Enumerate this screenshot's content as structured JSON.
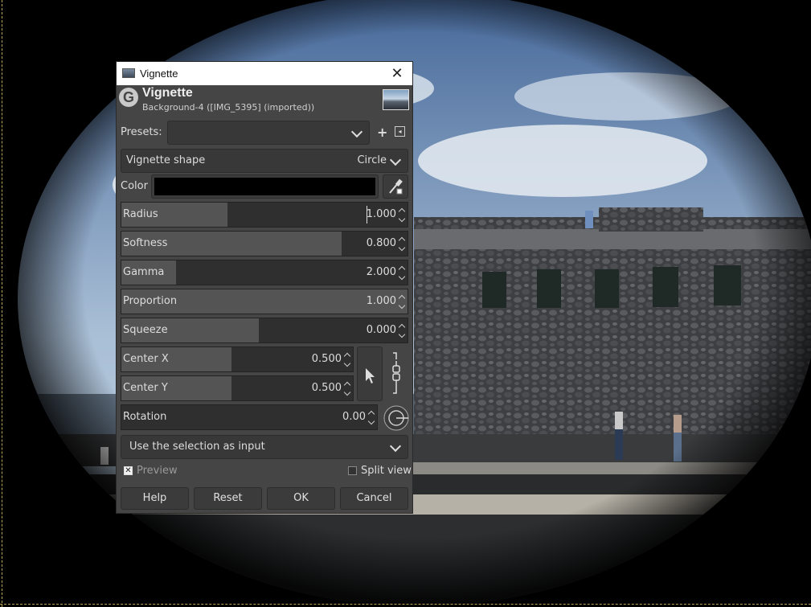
{
  "dialog": {
    "window_title": "Vignette",
    "title": "Vignette",
    "subtitle": "Background-4 ([IMG_5395] (imported))",
    "close_glyph": "✕",
    "presets_label": "Presets:",
    "presets_value": "",
    "shape_label": "Vignette shape",
    "shape_value": "Circle",
    "color_label": "Color",
    "color_value": "#000000",
    "sliders": [
      {
        "label": "Radius",
        "value": "1.000",
        "fraction": 0.37
      },
      {
        "label": "Softness",
        "value": "0.800",
        "fraction": 0.77
      },
      {
        "label": "Gamma",
        "value": "2.000",
        "fraction": 0.19
      },
      {
        "label": "Proportion",
        "value": "1.000",
        "fraction": 1.0
      },
      {
        "label": "Squeeze",
        "value": "0.000",
        "fraction": 0.48
      }
    ],
    "center_x": {
      "label": "Center X",
      "value": "0.500",
      "fraction": 0.475
    },
    "center_y": {
      "label": "Center Y",
      "value": "0.500",
      "fraction": 0.475
    },
    "rotation": {
      "label": "Rotation",
      "value": "0.00",
      "fraction": 0.0
    },
    "selection_input": "Use the selection as input",
    "preview_label": "Preview",
    "preview_checked": true,
    "split_view_label": "Split view",
    "split_view_checked": false,
    "buttons": {
      "help": "Help",
      "reset": "Reset",
      "ok": "OK",
      "cancel": "Cancel"
    },
    "icons": [
      "gimp-logo-icon",
      "add-preset-icon",
      "preset-menu-icon",
      "color-picker-icon",
      "pick-center-icon",
      "chain-link-icon",
      "rotation-dial-icon"
    ]
  }
}
